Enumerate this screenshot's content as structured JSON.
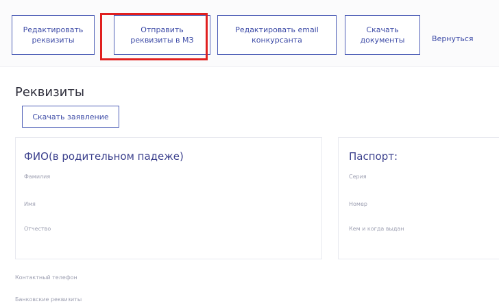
{
  "toolbar": {
    "edit_requisites": "Редактировать реквизиты",
    "send_requisites": "Отправить реквизиты в МЗ",
    "edit_email": "Редактировать email конкурсанта",
    "download_docs": "Скачать документы",
    "back": "Вернуться"
  },
  "section": {
    "title": "Реквизиты",
    "download_application": "Скачать заявление"
  },
  "fio_card": {
    "title": "ФИО(в родительном падеже)",
    "fields": [
      "Фамилия",
      "Имя",
      "Отчество"
    ]
  },
  "passport_card": {
    "title": "Паспорт:",
    "fields": [
      "Серия",
      "Номер",
      "Кем и когда выдан"
    ]
  },
  "bottom_fields": [
    "Контактный телефон",
    "Банковские реквизиты"
  ],
  "colors": {
    "accent": "#3c4aa6",
    "highlight": "#e01f1f"
  }
}
